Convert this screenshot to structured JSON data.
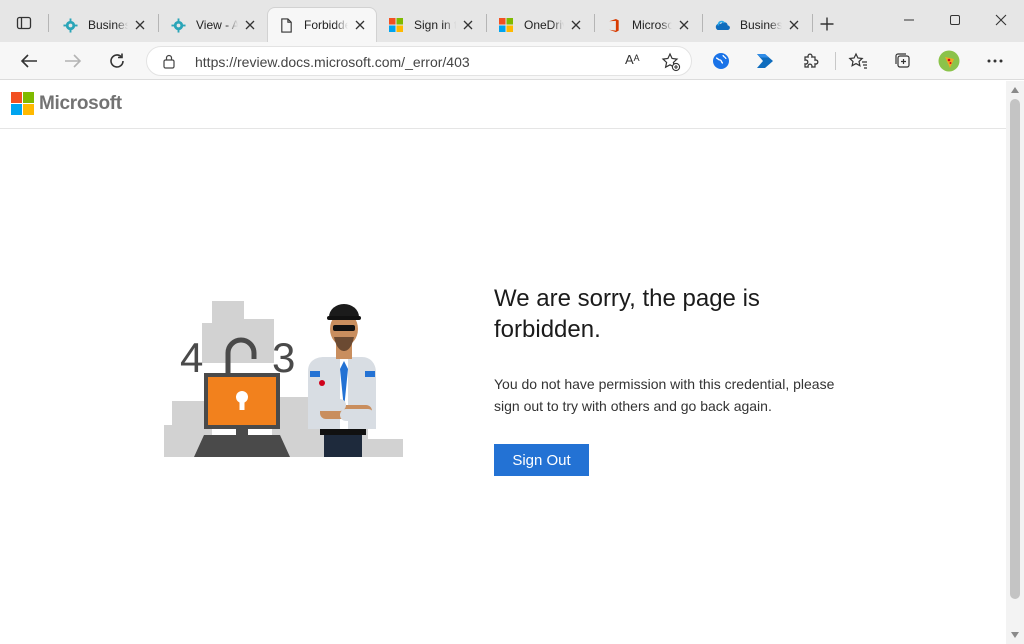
{
  "browser": {
    "tabs": [
      {
        "label": "Business",
        "icon": "gear-blue-icon",
        "active": false
      },
      {
        "label": "View - A",
        "icon": "gear-blue-icon",
        "active": false
      },
      {
        "label": "Forbidden",
        "icon": "page-icon",
        "active": true
      },
      {
        "label": "Sign in t",
        "icon": "microsoft-logo-icon",
        "active": false
      },
      {
        "label": "OneDrive",
        "icon": "microsoft-logo-icon",
        "active": false
      },
      {
        "label": "Microsoft",
        "icon": "office-logo-icon",
        "active": false
      },
      {
        "label": "Business",
        "icon": "onedrive-cloud-icon",
        "active": false
      }
    ],
    "address": {
      "url": "https://review.docs.microsoft.com/_error/403",
      "read_aloud": "Aᴬ"
    }
  },
  "page": {
    "brand": "Microsoft",
    "illustration": {
      "digits": [
        "4",
        "3"
      ]
    },
    "title": "We are sorry, the page is forbidden.",
    "message": "You do not have permission with this credential, please sign out to try with others and go back again.",
    "signout_label": "Sign Out"
  },
  "colors": {
    "accent": "#2372d4",
    "ms_red": "#f25022",
    "ms_green": "#7fba00",
    "ms_blue": "#00a4ef",
    "ms_yellow": "#ffb900",
    "lock_orange": "#f2811d"
  }
}
